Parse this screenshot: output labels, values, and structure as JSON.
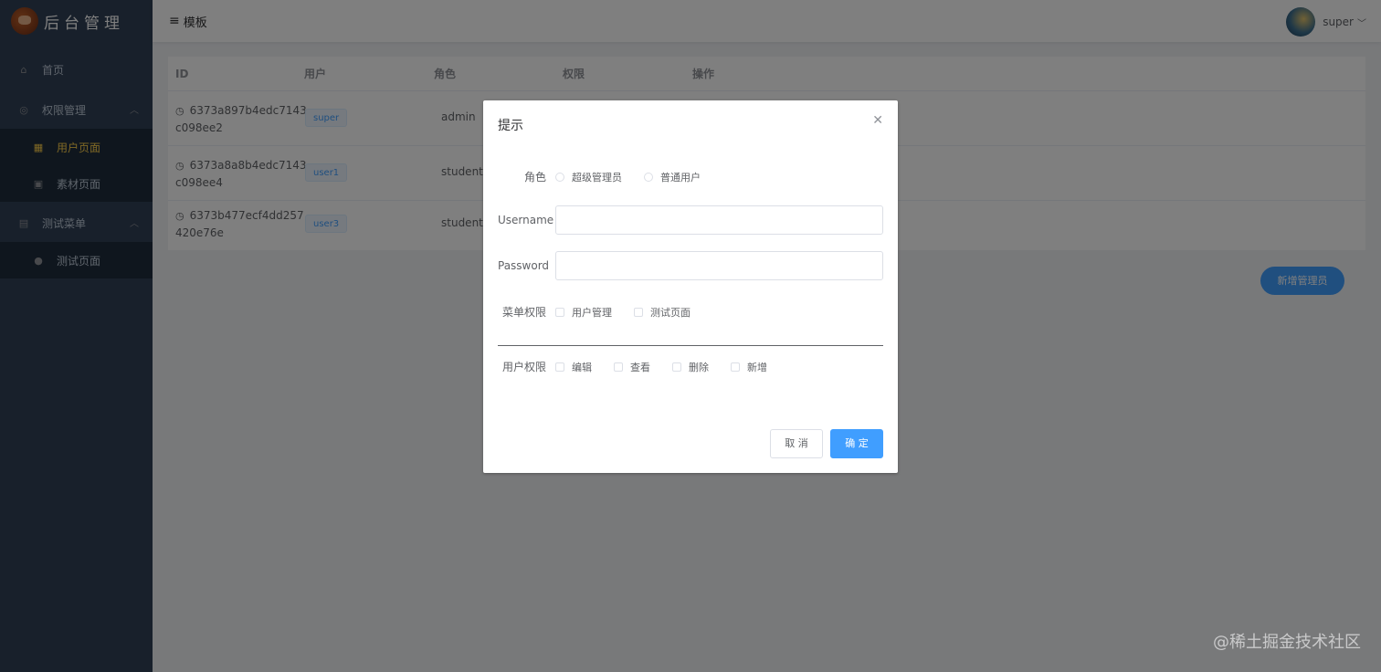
{
  "app": {
    "title": "后台管理",
    "logo_icon": "avatar-logo-icon"
  },
  "header": {
    "menu_icon": "≡",
    "title": "模板",
    "username": "super",
    "dropdown_icon": "chevron-down-icon"
  },
  "sidebar": {
    "items": [
      {
        "label": "首页",
        "icon": "home-icon"
      },
      {
        "label": "权限管理",
        "icon": "lock-icon",
        "expanded": true
      },
      {
        "label": "用户页面",
        "icon": "grid-icon",
        "active": true
      },
      {
        "label": "素材页面",
        "icon": "image-icon"
      },
      {
        "label": "测试菜单",
        "icon": "document-icon",
        "expanded": true
      },
      {
        "label": "测试页面",
        "icon": "user-icon"
      }
    ]
  },
  "table": {
    "columns": [
      "ID",
      "用户",
      "角色",
      "权限",
      "操作"
    ],
    "rows": [
      {
        "id_line1": "6373a897b4edc7143",
        "id_line2": "c098ee2",
        "user": "super",
        "role": "admin"
      },
      {
        "id_line1": "6373a8a8b4edc7143",
        "id_line2": "c098ee4",
        "user": "user1",
        "role": "student"
      },
      {
        "id_line1": "6373b477ecf4dd257",
        "id_line2": "420e76e",
        "user": "user3",
        "role": "student"
      }
    ]
  },
  "add_button": "新增管理员",
  "dialog": {
    "title": "提示",
    "role_label": "角色",
    "role_options": [
      "超级管理员",
      "普通用户"
    ],
    "username_label": "Username",
    "username_value": "",
    "password_label": "Password",
    "password_value": "",
    "menu_perm_label": "菜单权限",
    "menu_perm_options": [
      "用户管理",
      "测试页面"
    ],
    "user_perm_label": "用户权限",
    "user_perm_options": [
      "编辑",
      "查看",
      "删除",
      "新增"
    ],
    "cancel": "取 消",
    "confirm": "确 定"
  },
  "watermark": "@稀土掘金技术社区",
  "colors": {
    "sidebar_bg": "#304156",
    "accent": "#409eff",
    "active": "#ffd04b"
  }
}
